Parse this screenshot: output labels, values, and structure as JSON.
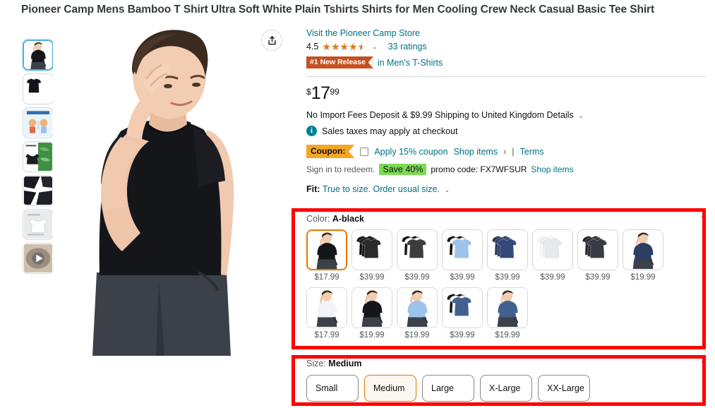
{
  "page_title": "Pioneer Camp Mens Bamboo T Shirt Ultra Soft White Plain Tshirts Shirts for Men Cooling Crew Neck Casual Basic Tee Shirt",
  "gallery": {
    "share_icon": "share-icon",
    "thumbnails": [
      {
        "name": "thumb-model-black-front",
        "selected": true,
        "kind": "model-black"
      },
      {
        "name": "thumb-shirt-black-flat",
        "selected": false,
        "kind": "shirt-black"
      },
      {
        "name": "thumb-infographic-cooling",
        "selected": false,
        "kind": "infographic"
      },
      {
        "name": "thumb-bamboo-fabric",
        "selected": false,
        "kind": "bamboo"
      },
      {
        "name": "thumb-fabric-closeup",
        "selected": false,
        "kind": "closeup"
      },
      {
        "name": "thumb-shirt-white-detail",
        "selected": false,
        "kind": "shirt-white"
      },
      {
        "name": "thumb-video",
        "selected": false,
        "kind": "video"
      }
    ]
  },
  "product": {
    "store_link": "Visit the Pioneer Camp Store",
    "rating_value": "4.5",
    "rating_stars": 4.5,
    "ratings_count": "33 ratings",
    "badge_rank": "#1 New Release",
    "badge_category": "in Men's T-Shirts",
    "price_symbol": "$",
    "price_whole": "17",
    "price_fraction": "99",
    "shipping_text": "No Import Fees Deposit & $9.99 Shipping to United Kingdom",
    "shipping_details": "Details",
    "tax_note": "Sales taxes may apply at checkout",
    "coupon_label": "Coupon:",
    "coupon_apply": "Apply 15% coupon",
    "coupon_shop_items": "Shop items",
    "coupon_separator": "|",
    "coupon_terms": "Terms",
    "promo_signin": "Sign in to redeem.",
    "promo_save": "Save 40%",
    "promo_code_text": "promo code: FX7WFSUR",
    "promo_shop_items": "Shop items",
    "fit_label": "Fit:",
    "fit_value": "True to size. Order usual size."
  },
  "color_section": {
    "label": "Color:",
    "value": "A-black",
    "collapse_icon": "chevron-up-icon",
    "rows": [
      [
        {
          "name": "swatch-a-black",
          "price": "$17.99",
          "selected": true,
          "kind": "model-black"
        },
        {
          "name": "swatch-3pack-black",
          "price": "$39.99",
          "selected": false,
          "kind": "stack-black"
        },
        {
          "name": "swatch-black-grey-mix",
          "price": "$39.99",
          "selected": false,
          "kind": "stack-blackgrey"
        },
        {
          "name": "swatch-lightblue-mix",
          "price": "$39.99",
          "selected": false,
          "kind": "stack-lightblue"
        },
        {
          "name": "swatch-navy-pack",
          "price": "$39.99",
          "selected": false,
          "kind": "stack-navy"
        },
        {
          "name": "swatch-white-pack",
          "price": "$39.99",
          "selected": false,
          "kind": "stack-white"
        },
        {
          "name": "swatch-darkgrey-pack",
          "price": "$39.99",
          "selected": false,
          "kind": "stack-darkgrey"
        },
        {
          "name": "swatch-navy-model",
          "price": "$19.99",
          "selected": false,
          "kind": "model-navy"
        }
      ],
      [
        {
          "name": "swatch-white-model",
          "price": "$17.99",
          "selected": false,
          "kind": "model-white"
        },
        {
          "name": "swatch-black-model-2",
          "price": "$19.99",
          "selected": false,
          "kind": "model-black"
        },
        {
          "name": "swatch-lightblue-model",
          "price": "$19.99",
          "selected": false,
          "kind": "model-lightblue"
        },
        {
          "name": "swatch-mixed-pack",
          "price": "$39.99",
          "selected": false,
          "kind": "stack-mixed"
        },
        {
          "name": "swatch-blue-model",
          "price": "$19.99",
          "selected": false,
          "kind": "model-blue"
        }
      ]
    ]
  },
  "size_section": {
    "label": "Size:",
    "value": "Medium",
    "collapse_icon": "chevron-up-icon",
    "options": [
      {
        "name": "size-small",
        "label": "Small",
        "selected": false
      },
      {
        "name": "size-medium",
        "label": "Medium",
        "selected": true
      },
      {
        "name": "size-large",
        "label": "Large",
        "selected": false
      },
      {
        "name": "size-xlarge",
        "label": "X-Large",
        "selected": false
      },
      {
        "name": "size-xxlarge",
        "label": "XX-Large",
        "selected": false
      }
    ]
  },
  "colors": {
    "teal_link": "#007185",
    "badge_orange": "#c7511f",
    "coupon_orange": "#f5a623",
    "save_green": "#7ed957",
    "star_orange": "#de7921",
    "selected_border": "#e77600",
    "annotation_red": "#ff0000"
  }
}
